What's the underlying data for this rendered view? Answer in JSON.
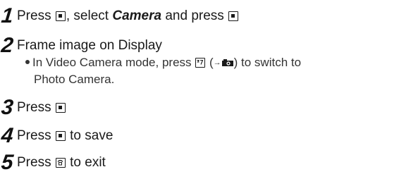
{
  "steps": [
    {
      "number": "1",
      "before": "Press ",
      "middle": ", select ",
      "emphasis": "Camera",
      "after_em": " and press ",
      "key1_icon": "center-key-icon",
      "key2_icon": "center-key-icon"
    },
    {
      "number": "2",
      "text": "Frame image on Display",
      "bullet_part1": "In Video Camera mode, press ",
      "bullet_paren_open": " (",
      "bullet_arrow": "→",
      "bullet_paren_close": ") to switch to",
      "bullet_line2": "Photo Camera.",
      "key_icon": "video-photo-toggle-key-icon",
      "small_icon": "photo-camera-icon"
    },
    {
      "number": "3",
      "text": "Press ",
      "key_icon": "center-key-icon"
    },
    {
      "number": "4",
      "before": "Press ",
      "after": " to save",
      "key_icon": "center-key-icon"
    },
    {
      "number": "5",
      "before": "Press ",
      "after": " to exit",
      "key_icon": "end-key-icon"
    }
  ]
}
